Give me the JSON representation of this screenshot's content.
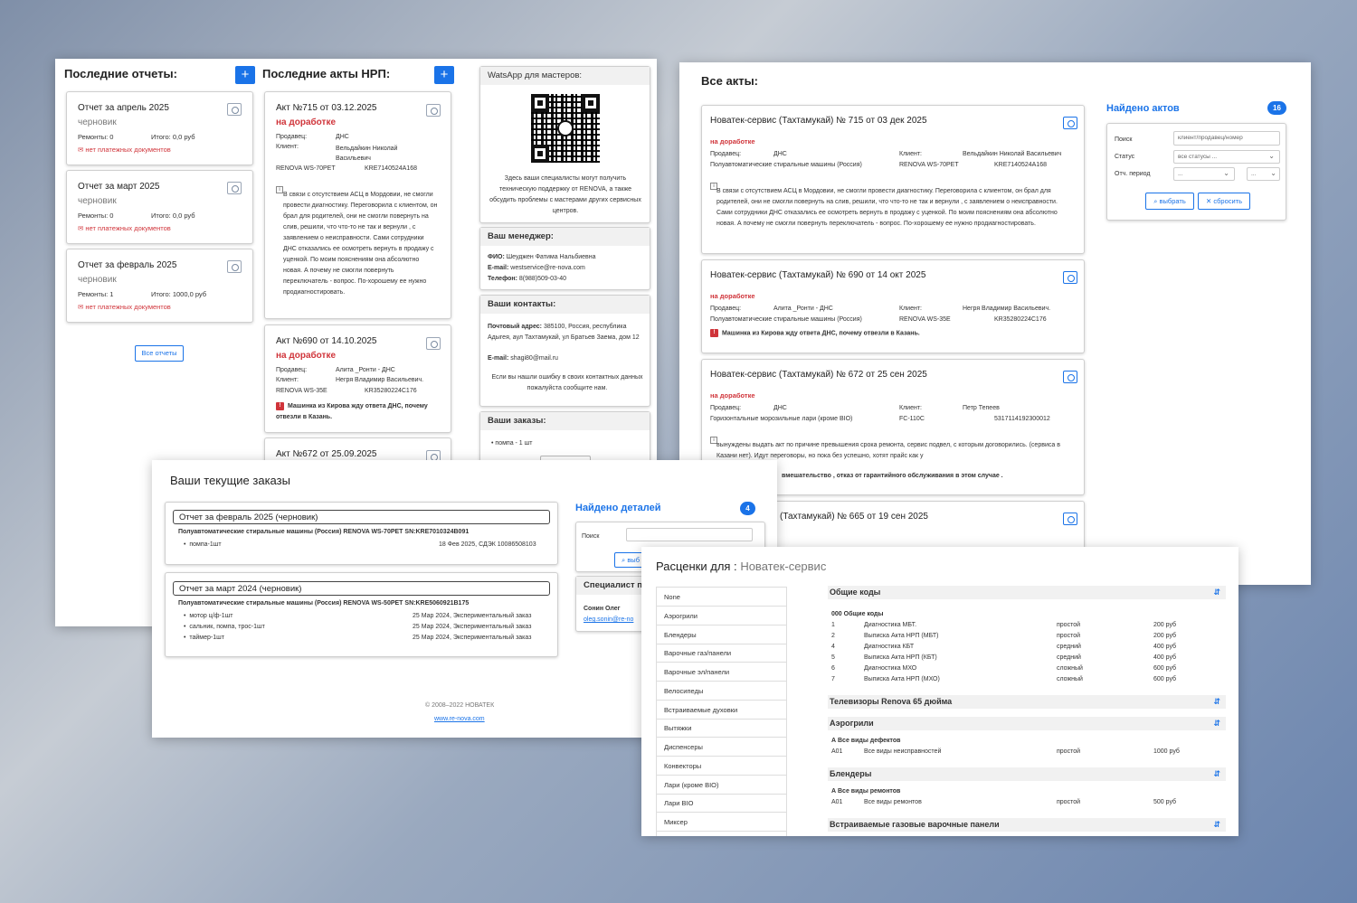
{
  "panel1": {
    "reports_title": "Последние отчеты:",
    "acts_title": "Последние акты НРП:",
    "plus": "+",
    "reports": [
      {
        "title": "Отчет за апрель 2025",
        "status": "черновик",
        "repairs": "Ремонты: 0",
        "total": "Итого: 0,0 руб",
        "warning": "нет платежных документов"
      },
      {
        "title": "Отчет за март 2025",
        "status": "черновик",
        "repairs": "Ремонты: 0",
        "total": "Итого: 0,0 руб",
        "warning": "нет платежных документов"
      },
      {
        "title": "Отчет за февраль 2025",
        "status": "черновик",
        "repairs": "Ремонты: 1",
        "total": "Итого: 1000,0 руб",
        "warning": "нет платежных документов"
      }
    ],
    "all_reports": "Все отчеты",
    "acts": [
      {
        "title": "Акт №715 от 03.12.2025",
        "status": "на доработке",
        "seller_label": "Продавец:",
        "seller": "ДНС",
        "client_label": "Клиент:",
        "client": "Вельдайкин Николай Васильевич",
        "model": "RENOVA WS-70PET",
        "serial": "KRE7140524A168",
        "note": "В связи с отсутствием АСЦ в Мордовии, не смогли провести диагностику. Переговорила с клиентом, он брал для родителей, они не смогли повернуть на слив, решили, что что-то не так и вернули , с заявлением о неисправности. Сами сотрудники ДНС отказались ее осмотреть вернуть в продажу с уценкой. По моим пояснениям она абсолютно новая. А почему не смогли повернуть переключатель - вопрос. По-хорошему ее нужно продиагностировать."
      },
      {
        "title": "Акт №690 от 14.10.2025",
        "status": "на доработке",
        "seller_label": "Продавец:",
        "seller": "Алита _Ронти - ДНС",
        "client_label": "Клиент:",
        "client": "Негря Владимир Васильевич.",
        "model": "RENOVA WS-35E",
        "serial": "KR35280224C176",
        "note": "Машинка из Кирова жду ответа ДНС, почему отвезли в Казань."
      },
      {
        "title": "Акт №672 от 25.09.2025"
      }
    ],
    "whatsapp": {
      "title": "WatsApp для мастеров:",
      "text": "Здесь ваши специалисты могут получить техническую поддержку от RENOVA, а также обсудить проблемы с мастерами других сервисных центров."
    },
    "manager": {
      "title": "Ваш менеджер:",
      "fio_label": "ФИО:",
      "fio": "Шеуджен Фатима Нальбиевна",
      "email_label": "E-mail:",
      "email": "westservice@re-nova.com",
      "phone_label": "Телефон:",
      "phone": "8(988)509-03-40"
    },
    "contacts": {
      "title": "Ваши контакты:",
      "addr_label": "Почтовый адрес:",
      "addr": "385100, Россия, республика Адыгея, аул Тахтамукай, ул Братьев Заема, дом 12",
      "email_label": "E-mail:",
      "email": "shagi80@mail.ru",
      "note": "Если вы нашли ошибку в своих контактных данных пожалуйста сообщите нам."
    },
    "orders": {
      "title": "Ваши заказы:",
      "items": [
        "помпа - 1 шт"
      ]
    }
  },
  "panel2": {
    "title": "Все акты:",
    "found_label": "Найдено актов",
    "found_count": "16",
    "filters": {
      "search_label": "Поиск",
      "search_placeholder": "клиент/продавец/номер",
      "status_label": "Статус",
      "status_value": "все статусы ...",
      "period_label": "Отч. период",
      "period_from": "...",
      "period_to": "...",
      "apply": "выбрать",
      "reset": "сбросить"
    },
    "acts": [
      {
        "title": "Новатек-сервис (Тахтамукай) № 715 от 03 дек 2025",
        "status": "на доработке",
        "seller_label": "Продавец:",
        "seller": "ДНС",
        "category": "Полуавтоматические стиральные машины (Россия)",
        "client_label": "Клиент:",
        "client": "Вельдайкин Николай Васильевич",
        "model": "RENOVA WS-70PET",
        "serial": "KRE7140524A168",
        "note": "В связи с отсутствием АСЦ в Мордовии, не смогли провести диагностику. Переговорила с клиентом, он брал для родителей, они не смогли повернуть на слив, решили, что что-то не так и вернули , с заявлением о неисправности. Сами сотрудники ДНС отказались ее осмотреть вернуть в продажу с уценкой. По моим пояснениям она абсолютно новая. А почему не смогли повернуть переключатель - вопрос. По-хорошему ее нужно продиагностировать."
      },
      {
        "title": "Новатек-сервис (Тахтамукай) № 690 от 14 окт 2025",
        "status": "на доработке",
        "seller_label": "Продавец:",
        "seller": "Алита _Ронти - ДНС",
        "category": "Полуавтоматические стиральные машины (Россия)",
        "client_label": "Клиент:",
        "client": "Негря Владимир Васильевич.",
        "model": "RENOVA WS-35E",
        "serial": "KR35280224C176",
        "note": "Машинка из Кирова жду ответа ДНС, почему отвезли в Казань."
      },
      {
        "title": "Новатек-сервис (Тахтамукай) № 672 от 25 сен 2025",
        "status": "на доработке",
        "seller_label": "Продавец:",
        "seller": "ДНС",
        "category": "Горизонтальные морозильные лари (кроме BIO)",
        "client_label": "Клиент:",
        "client": "Петр Тепеев",
        "model": "FC-110C",
        "serial": "5317114192300012",
        "note": "вынуждены выдать акт по причине превышения срока ремонта, сервис подвел, с которым договорились. (сервиса в Казани нет). Идут переговоры, но пока без успешно, хотят прайс как у",
        "note2": "вмешательство , отказ от гарантийного обслуживания в этом случае ."
      },
      {
        "title": "(Тахтамукай) № 665 от 19 сен 2025"
      }
    ]
  },
  "panel3": {
    "title": "Ваши текущие заказы",
    "orders": [
      {
        "head": "Отчет за февраль 2025 (черновик)",
        "product": "Полуавтоматические стиральные машины (Россия) RENOVA WS-70PET SN:KRE7010324B091",
        "items": [
          {
            "name": "помпа-1шт",
            "info": "18 Фев 2025, СДЭК 10086508103"
          }
        ]
      },
      {
        "head": "Отчет за март 2024 (черновик)",
        "product": "Полуавтоматические стиральные машины (Россия) RENOVA WS-50PET SN:KRE5060921B175",
        "items": [
          {
            "name": "мотор ц/ф-1шт",
            "info": "25 Мар 2024, Экспериментальный заказ"
          },
          {
            "name": "сальник, помпа, трос-1шт",
            "info": "25 Мар 2024, Экспериментальный заказ"
          },
          {
            "name": "таймер-1шт",
            "info": "25 Мар 2024, Экспериментальный заказ"
          }
        ]
      }
    ],
    "found_label": "Найдено деталей",
    "found_count": "4",
    "search_label": "Поиск",
    "apply": "выб",
    "specialist_title": "Специалист п",
    "specialist_name": "Сонин Олег",
    "specialist_email": "oleg.sonin@re-no",
    "copyright": "© 2008–2022 НОВАТЕК",
    "link": "www.re-nova.com"
  },
  "panel4": {
    "title_prefix": "Расценки для :",
    "title_company": "Новатек-сервис",
    "sidebar": [
      "None",
      "Аэрогрили",
      "Блендеры",
      "Варочные газ/панели",
      "Варочные эл/панели",
      "Велосипеды",
      "Встраиваемые духовки",
      "Вытяжки",
      "Диспенсеры",
      "Конвекторы",
      "Лари (кроме BIO)",
      "Лари BIO",
      "Миксер"
    ],
    "sections": [
      {
        "name": "Общие коды",
        "group": "000 Общие коды",
        "rows": [
          {
            "code": "1",
            "name": "Диагностика МБТ.",
            "level": "простой",
            "price": "200 руб"
          },
          {
            "code": "2",
            "name": "Выписка Акта НРП (МБТ)",
            "level": "простой",
            "price": "200 руб"
          },
          {
            "code": "4",
            "name": "Диагностика КБТ",
            "level": "средний",
            "price": "400 руб"
          },
          {
            "code": "5",
            "name": "Выписка Акта НРП (КБТ)",
            "level": "средний",
            "price": "400 руб"
          },
          {
            "code": "6",
            "name": "Диагностика МХО",
            "level": "сложный",
            "price": "600 руб"
          },
          {
            "code": "7",
            "name": "Выписка Акта НРП (МХО)",
            "level": "сложный",
            "price": "600 руб"
          }
        ]
      },
      {
        "name": "Телевизоры Renova 65 дюйма"
      },
      {
        "name": "Аэрогрили",
        "group": "А Все виды дефектов",
        "rows": [
          {
            "code": "A01",
            "name": "Все виды неисправностей",
            "level": "простой",
            "price": "1000 руб"
          }
        ]
      },
      {
        "name": "Блендеры",
        "group": "А Все виды ремонтов",
        "rows": [
          {
            "code": "A01",
            "name": "Все виды ремонтов",
            "level": "простой",
            "price": "500 руб"
          }
        ]
      },
      {
        "name": "Встраиваемые газовые варочные панели"
      }
    ],
    "sort_icon": "⇵"
  }
}
